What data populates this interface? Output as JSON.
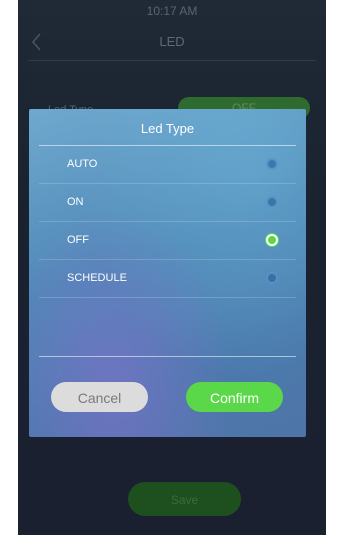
{
  "status_bar": {
    "time": "10:17 AM"
  },
  "header": {
    "title": "LED",
    "back_icon": "chevron-left-icon"
  },
  "background_row": {
    "label": "Led Type",
    "value": "OFF"
  },
  "save_label": "Save",
  "dialog": {
    "title": "Led Type",
    "options": [
      {
        "label": "AUTO",
        "selected": false
      },
      {
        "label": "ON",
        "selected": false
      },
      {
        "label": "OFF",
        "selected": true
      },
      {
        "label": "SCHEDULE",
        "selected": false
      }
    ],
    "cancel_label": "Cancel",
    "confirm_label": "Confirm"
  },
  "colors": {
    "accent_green": "#5bd84a",
    "dialog_blue": "#4f87b6"
  }
}
